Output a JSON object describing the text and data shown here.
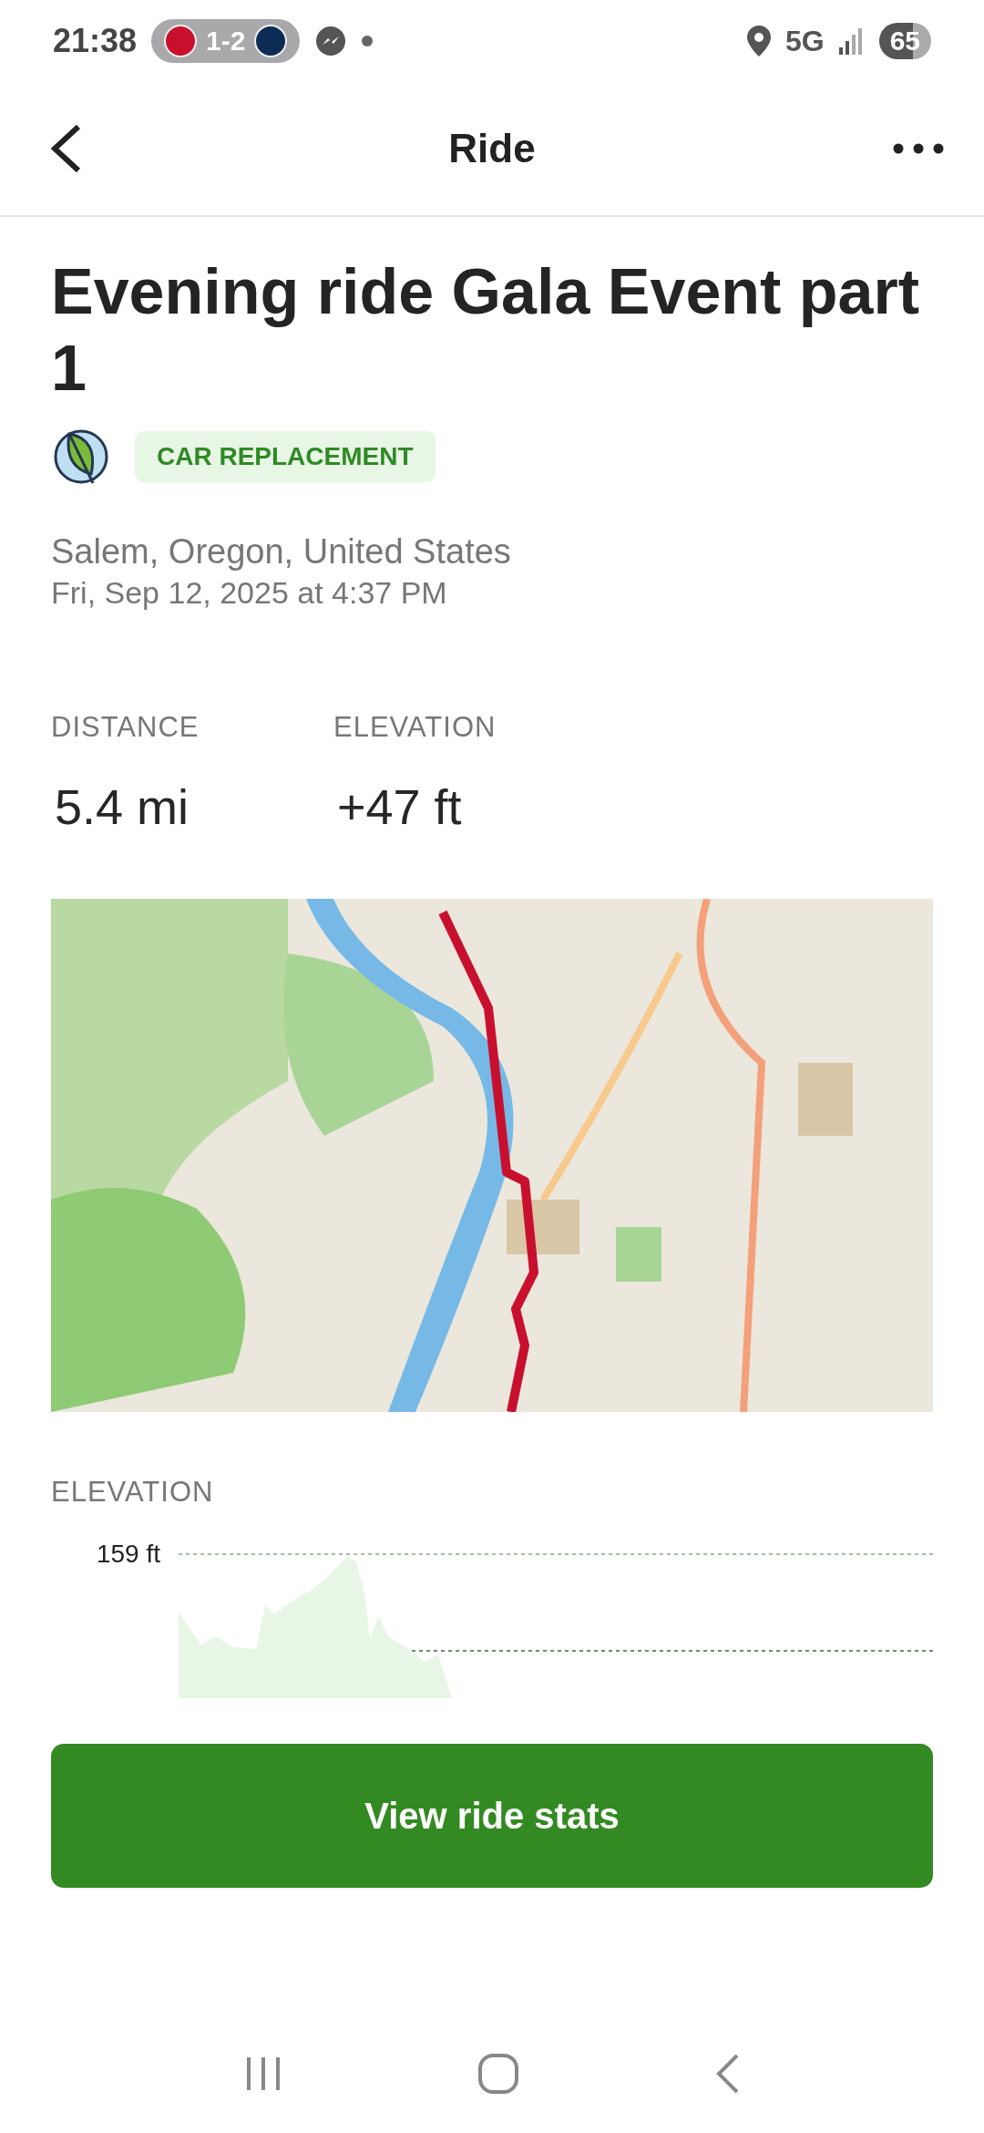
{
  "status_bar": {
    "time": "21:38",
    "score": "1-2",
    "network": "5G",
    "battery": "65"
  },
  "header": {
    "title": "Ride"
  },
  "ride": {
    "title": "Evening ride Gala Event part 1",
    "tag": "CAR REPLACEMENT",
    "location": "Salem, Oregon, United States",
    "datetime": "Fri, Sep 12, 2025 at 4:37 PM"
  },
  "stats": [
    {
      "label": "DISTANCE",
      "value": "5.4 mi"
    },
    {
      "label": "ELEVATION",
      "value": "+47 ft"
    }
  ],
  "elevation": {
    "label": "ELEVATION",
    "max_label": "159 ft"
  },
  "button": "View ride stats"
}
